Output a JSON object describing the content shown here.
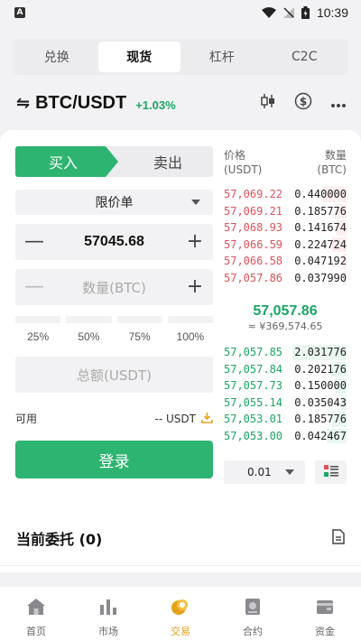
{
  "status_bar": {
    "time": "10:39",
    "left_badge": "A"
  },
  "top_tabs": [
    "兑换",
    "现货",
    "杠杆",
    "C2C"
  ],
  "pair": {
    "name": "BTC/USDT",
    "change": "+1.03%"
  },
  "trade": {
    "buy_label": "买入",
    "sell_label": "卖出",
    "order_type": "限价单",
    "price_value": "57045.68",
    "qty_placeholder": "数量(BTC)",
    "percentages": [
      "25%",
      "50%",
      "75%",
      "100%"
    ],
    "total_placeholder": "总额(USDT)",
    "available_label": "可用",
    "available_value": "-- USDT",
    "login_label": "登录"
  },
  "orderbook": {
    "price_header": "价格",
    "price_unit": "(USDT)",
    "qty_header": "数量",
    "qty_unit": "(BTC)",
    "asks": [
      {
        "price": "57,069.22",
        "qty": "0.440000",
        "depth": 0.44
      },
      {
        "price": "57,069.21",
        "qty": "0.185776",
        "depth": 0.22
      },
      {
        "price": "57,068.93",
        "qty": "0.141674",
        "depth": 0.18
      },
      {
        "price": "57,066.59",
        "qty": "0.224724",
        "depth": 0.26
      },
      {
        "price": "57,066.58",
        "qty": "0.047192",
        "depth": 0.08
      },
      {
        "price": "57,057.86",
        "qty": "0.037990",
        "depth": 0.06
      }
    ],
    "mid_price": "57,057.86",
    "mid_fiat": "≈ ¥369,574.65",
    "bids": [
      {
        "price": "57,057.85",
        "qty": "2.031776",
        "depth": 1.0
      },
      {
        "price": "57,057.84",
        "qty": "0.202176",
        "depth": 0.28
      },
      {
        "price": "57,057.73",
        "qty": "0.150000",
        "depth": 0.22
      },
      {
        "price": "57,055.14",
        "qty": "0.035043",
        "depth": 0.1
      },
      {
        "price": "57,053.01",
        "qty": "0.185776",
        "depth": 0.26
      },
      {
        "price": "57,053.00",
        "qty": "0.042467",
        "depth": 0.36
      }
    ],
    "depth_value": "0.01"
  },
  "orders": {
    "title": "当前委托 (0)"
  },
  "nav": [
    {
      "label": "首页",
      "icon": "home-icon"
    },
    {
      "label": "市场",
      "icon": "market-icon"
    },
    {
      "label": "交易",
      "icon": "trade-icon"
    },
    {
      "label": "合约",
      "icon": "futures-icon"
    },
    {
      "label": "资金",
      "icon": "wallet-icon"
    }
  ],
  "colors": {
    "green": "#2db471",
    "red": "#e0515a",
    "active_nav": "#e6a21a"
  }
}
